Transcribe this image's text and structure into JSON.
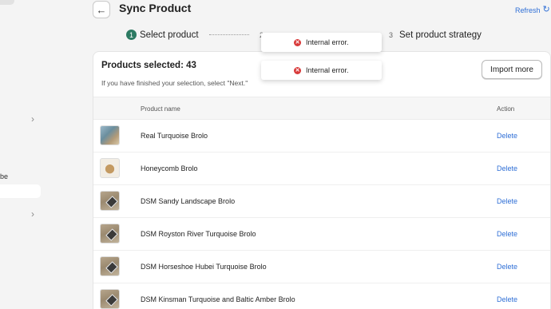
{
  "sidebar": {
    "partial_label": "be",
    "chevron_glyph": "›"
  },
  "header": {
    "back_glyph": "←",
    "title": "Sync Product",
    "refresh_label": "Refresh",
    "refresh_glyph": "↻"
  },
  "steps": [
    {
      "number": "1",
      "label": "Select product",
      "status": "active"
    },
    {
      "number": "2",
      "label": "",
      "status": "pending"
    },
    {
      "number": "3",
      "label": "Set product strategy",
      "status": "pending"
    }
  ],
  "toasts": [
    {
      "message": "Internal error.",
      "icon": "error-icon"
    },
    {
      "message": "Internal error.",
      "icon": "error-icon"
    }
  ],
  "selection": {
    "title": "Products selected: 43",
    "hint": "If you have finished your selection, select \"Next.\"",
    "import_label": "Import more"
  },
  "table": {
    "columns": [
      "Product name",
      "Action"
    ],
    "rows": [
      {
        "name": "Real Turquoise Brolo",
        "action": "Delete",
        "thumb": "photo"
      },
      {
        "name": "Honeycomb Brolo",
        "action": "Delete",
        "thumb": "comb"
      },
      {
        "name": "DSM Sandy Landscape Brolo",
        "action": "Delete",
        "thumb": "wood"
      },
      {
        "name": "DSM Royston River Turquoise Brolo",
        "action": "Delete",
        "thumb": "wood"
      },
      {
        "name": "DSM Horseshoe Hubei Turquoise Brolo",
        "action": "Delete",
        "thumb": "wood"
      },
      {
        "name": "DSM Kinsman Turquoise and Baltic Amber Brolo",
        "action": "Delete",
        "thumb": "wood"
      }
    ]
  },
  "colors": {
    "accent": "#2c7a62",
    "link": "#2f6fd6",
    "error": "#d83a3a"
  }
}
